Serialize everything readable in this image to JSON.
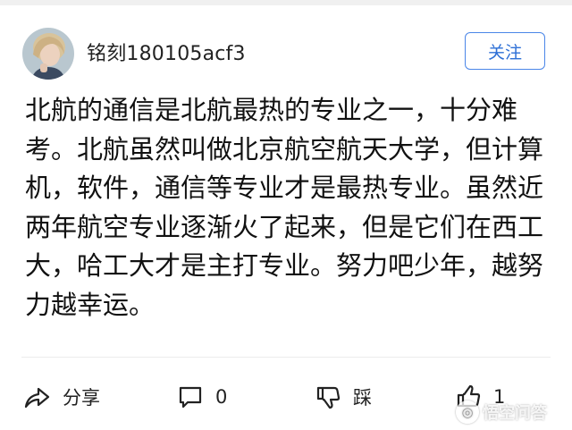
{
  "user": {
    "name": "铭刻180105acf3",
    "follow_label": "关注"
  },
  "answer": {
    "text": "北航的通信是北航最热的专业之一，十分难考。北航虽然叫做北京航空航天大学，但计算机，软件，通信等专业才是最热专业。虽然近两年航空专业逐渐火了起来，但是它们在西工大，哈工大才是主打专业。努力吧少年，越努力越幸运。"
  },
  "actions": {
    "share_label": "分享",
    "comment_count": "0",
    "dislike_label": "踩",
    "like_count": "1"
  },
  "watermark": {
    "text": "悟空问答"
  },
  "colors": {
    "accent": "#2d6fd6",
    "text": "#111111",
    "divider": "#ececec"
  },
  "icons": [
    "share-icon",
    "comment-icon",
    "dislike-icon",
    "like-icon"
  ]
}
